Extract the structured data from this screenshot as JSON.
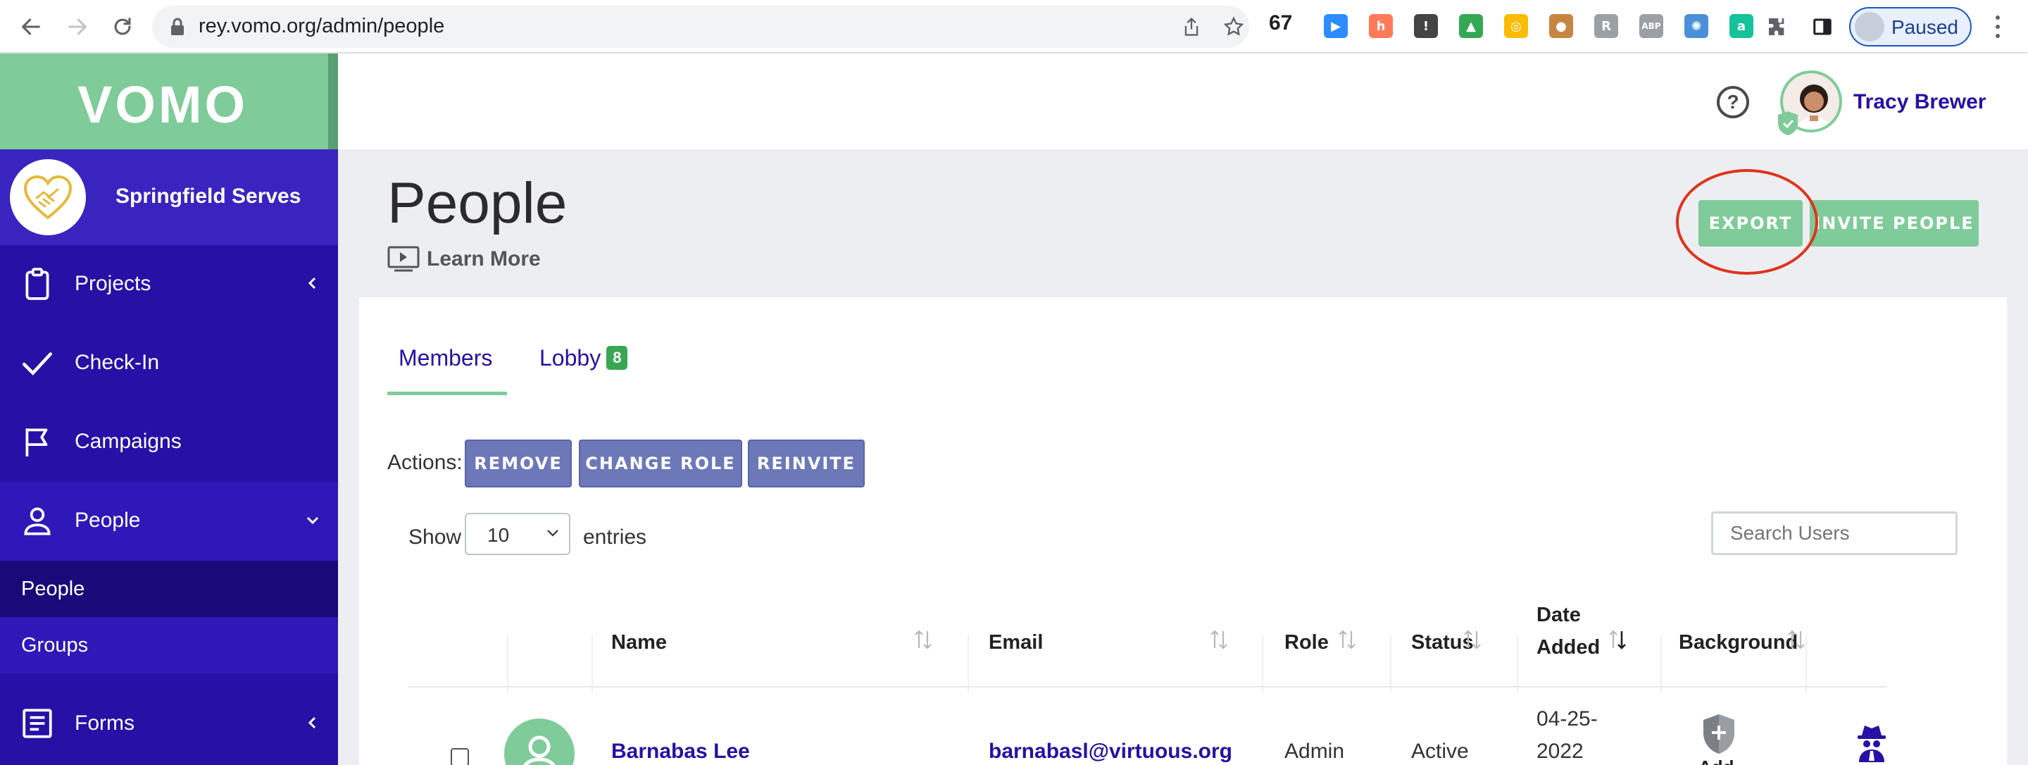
{
  "browser": {
    "url": "rey.vomo.org/admin/people",
    "ext_count": "67",
    "profile_label": "Paused",
    "extensions": [
      {
        "name": "zoom-icon",
        "color": "#2d8cff",
        "glyph": "▶"
      },
      {
        "name": "hubspot-icon",
        "color": "#ff7a59",
        "glyph": "h"
      },
      {
        "name": "onepassword-icon",
        "color": "#444444",
        "glyph": "!"
      },
      {
        "name": "google-drive-icon",
        "color": "#34a853",
        "glyph": "▲"
      },
      {
        "name": "colorful-circle-icon",
        "color": "#fbbc05",
        "glyph": "◎"
      },
      {
        "name": "cookie-icon",
        "color": "#c68642",
        "glyph": "●"
      },
      {
        "name": "grey-ext-icon",
        "color": "#9aa0a6",
        "glyph": "R"
      },
      {
        "name": "adblock-plus-icon",
        "color": "#9aa0a6",
        "glyph": "ABP"
      },
      {
        "name": "gear-ext-icon",
        "color": "#4a90d9",
        "glyph": "✺"
      },
      {
        "name": "grammarly-icon",
        "color": "#15c39a",
        "glyph": "a"
      }
    ]
  },
  "sidebar": {
    "logo": "VOMO",
    "org_name": "Springfield Serves",
    "items": [
      {
        "label": "Projects"
      },
      {
        "label": "Check-In"
      },
      {
        "label": "Campaigns"
      },
      {
        "label": "People"
      },
      {
        "label": "Forms"
      }
    ],
    "sub_items": [
      {
        "label": "People"
      },
      {
        "label": "Groups"
      }
    ]
  },
  "header": {
    "help_glyph": "?",
    "user_name": "Tracy Brewer"
  },
  "page": {
    "title": "People",
    "learn_more": "Learn More",
    "export_label": "EXPORT",
    "invite_label": "INVITE PEOPLE"
  },
  "tabs": [
    {
      "label": "Members"
    },
    {
      "label": "Lobby",
      "badge": "8"
    }
  ],
  "actions": {
    "label": "Actions:",
    "buttons": [
      {
        "label": "REMOVE"
      },
      {
        "label": "CHANGE ROLE"
      },
      {
        "label": "REINVITE"
      }
    ]
  },
  "table_controls": {
    "show_label": "Show",
    "entries_value": "10",
    "entries_label": "entries",
    "search_placeholder": "Search Users"
  },
  "table": {
    "columns": [
      {
        "label": "Name"
      },
      {
        "label": "Email"
      },
      {
        "label": "Role"
      },
      {
        "label": "Status"
      },
      {
        "label": "Date Added"
      },
      {
        "label": "Background"
      }
    ],
    "rows": [
      {
        "name": "Barnabas Lee",
        "email": "barnabasl@virtuous.org",
        "role": "Admin",
        "status": "Active",
        "date_added": "04-25-2022",
        "date_line1": "04-25-",
        "date_line2": "2022",
        "background": "Add"
      }
    ]
  },
  "colors": {
    "brand_green": "#7fcb99",
    "sidebar_purple": "#2610a6",
    "action_button": "#6d78b8",
    "annotation_red": "#e0341a"
  }
}
